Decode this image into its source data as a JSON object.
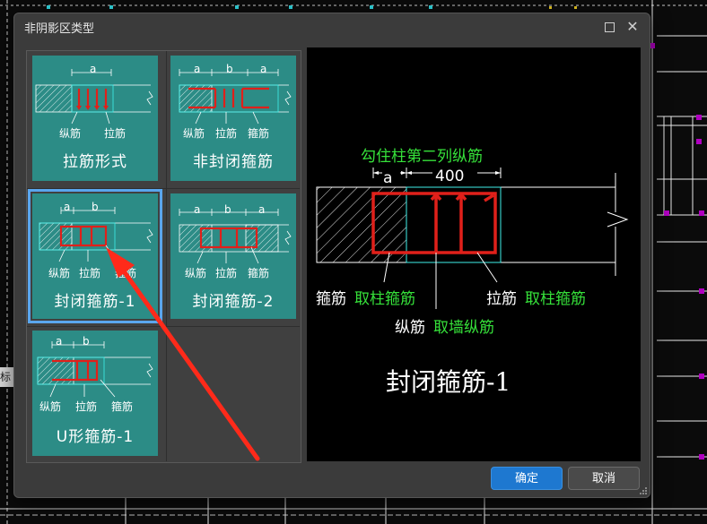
{
  "background": {
    "side_tab_text": "标",
    "line_color": "#e8e8e8",
    "accent_color": "#b000c0"
  },
  "dialog": {
    "title": "非阴影区类型",
    "maximize_icon": "maximize-icon",
    "close_icon": "close-icon"
  },
  "tiles": [
    {
      "label": "拉筋形式",
      "labels": [
        "纵筋",
        "拉筋"
      ],
      "dims": [
        "a"
      ]
    },
    {
      "label": "非封闭箍筋",
      "labels": [
        "纵筋",
        "拉筋",
        "箍筋"
      ],
      "dims": [
        "a",
        "b",
        "a"
      ]
    },
    {
      "label": "封闭箍筋-1",
      "labels": [
        "纵筋",
        "拉筋",
        "箍筋"
      ],
      "dims": [
        "a",
        "b"
      ],
      "selected": true
    },
    {
      "label": "封闭箍筋-2",
      "labels": [
        "纵筋",
        "拉筋",
        "箍筋"
      ],
      "dims": [
        "a",
        "b",
        "a"
      ]
    },
    {
      "label": "U形箍筋-1",
      "labels": [
        "纵筋",
        "拉筋",
        "箍筋"
      ],
      "dims": [
        "a",
        "b"
      ]
    }
  ],
  "preview": {
    "top_label": "勾住柱第二列纵筋",
    "dim_a": "a",
    "dim_400": "400",
    "left_label_white": "箍筋",
    "left_label_green": "取柱箍筋",
    "right_label_white": "拉筋",
    "right_label_green": "取柱箍筋",
    "bottom_label_white": "纵筋",
    "bottom_label_green": "取墙纵筋",
    "title": "封闭箍筋-1"
  },
  "buttons": {
    "ok": "确定",
    "cancel": "取消"
  },
  "colors": {
    "tile_bg": "#2c8c86",
    "selected_outline": "#5aa6ee",
    "rebar_red": "#e0201a",
    "green_text": "#36e23a",
    "ok_button": "#1e78d0"
  }
}
